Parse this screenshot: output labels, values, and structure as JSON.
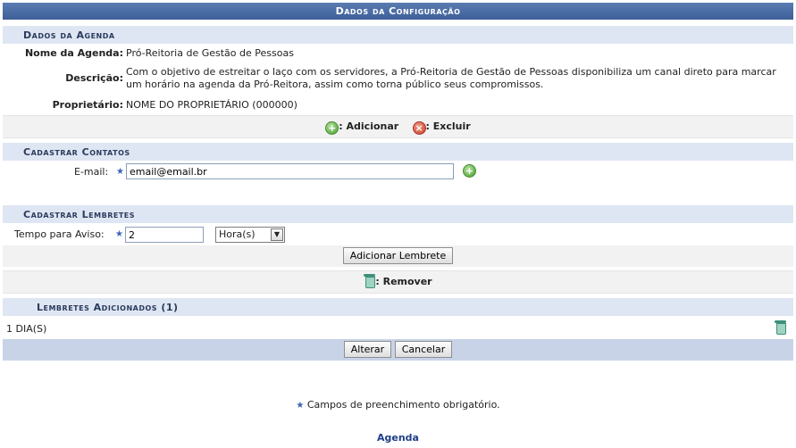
{
  "title": "Dados da Configuração",
  "agenda": {
    "section": "Dados da Agenda",
    "name_label": "Nome da Agenda:",
    "name_value": "Pró-Reitoria de Gestão de Pessoas",
    "desc_label": "Descrição:",
    "desc_value": "Com o objetivo de estreitar o laço com os servidores, a Pró-Reitoria de Gestão de Pessoas disponibiliza um canal direto para marcar um horário na agenda da Pró-Reitora, assim como torna público seus compromissos.",
    "owner_label": "Proprietário:",
    "owner_value": "NOME DO PROPRIETÁRIO (000000)"
  },
  "legend1": {
    "add": ": Adicionar",
    "del": ": Excluir"
  },
  "contatos": {
    "section": "Cadastrar Contatos",
    "email_label": "E-mail:",
    "email_value": "email@email.br"
  },
  "lembretes": {
    "section": "Cadastrar Lembretes",
    "tempo_label": "Tempo para Aviso:",
    "tempo_value": "2",
    "unit_value": "Hora(s)",
    "add_button": "Adicionar Lembrete"
  },
  "legend2": {
    "remove": ": Remover"
  },
  "adicionados": {
    "section": "Lembretes Adicionados (1)",
    "items": [
      "1 DIA(S)"
    ]
  },
  "buttons": {
    "alterar": "Alterar",
    "cancelar": "Cancelar"
  },
  "required_note": "Campos de preenchimento obrigatório.",
  "footer_link": "Agenda"
}
